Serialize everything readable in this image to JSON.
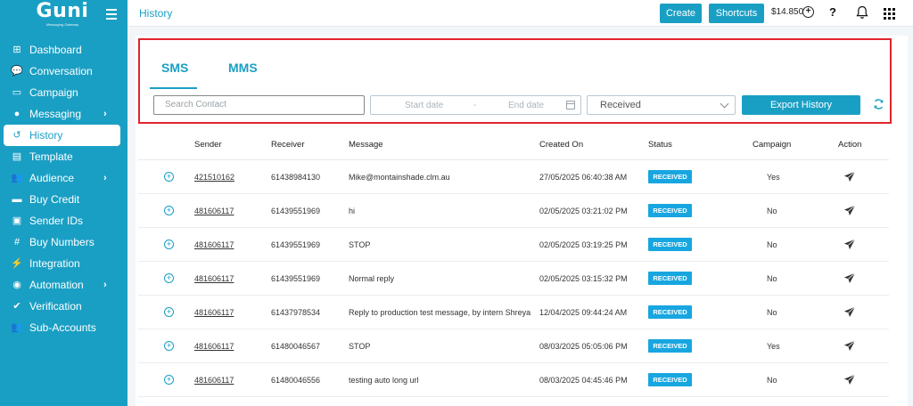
{
  "brand": {
    "logo_text": "Guni",
    "logo_sub": "Messaging Gateway"
  },
  "sidebar": {
    "items": [
      {
        "label": "Dashboard",
        "icon": "dashboard-icon",
        "glyph": "⊞",
        "has_submenu": false
      },
      {
        "label": "Conversation",
        "icon": "chat-icon",
        "glyph": "💬",
        "has_submenu": false
      },
      {
        "label": "Campaign",
        "icon": "inbox-icon",
        "glyph": "▭",
        "has_submenu": false
      },
      {
        "label": "Messaging",
        "icon": "message-icon",
        "glyph": "●",
        "has_submenu": true
      },
      {
        "label": "History",
        "icon": "history-icon",
        "glyph": "↺",
        "has_submenu": false,
        "active": true
      },
      {
        "label": "Template",
        "icon": "document-icon",
        "glyph": "▤",
        "has_submenu": false
      },
      {
        "label": "Audience",
        "icon": "users-icon",
        "glyph": "👥",
        "has_submenu": true
      },
      {
        "label": "Buy Credit",
        "icon": "wallet-icon",
        "glyph": "▬",
        "has_submenu": false
      },
      {
        "label": "Sender IDs",
        "icon": "id-card-icon",
        "glyph": "▣",
        "has_submenu": false
      },
      {
        "label": "Buy Numbers",
        "icon": "hash-icon",
        "glyph": "#",
        "has_submenu": false
      },
      {
        "label": "Integration",
        "icon": "plug-icon",
        "glyph": "⚡",
        "has_submenu": false
      },
      {
        "label": "Automation",
        "icon": "robot-icon",
        "glyph": "◉",
        "has_submenu": true
      },
      {
        "label": "Verification",
        "icon": "check-circle-icon",
        "glyph": "✔",
        "has_submenu": false
      },
      {
        "label": "Sub-Accounts",
        "icon": "accounts-icon",
        "glyph": "👥",
        "has_submenu": false
      }
    ]
  },
  "header": {
    "title": "History",
    "create_label": "Create",
    "shortcuts_label": "Shortcuts",
    "balance": "$14.850",
    "help_label": "?"
  },
  "tabs": [
    {
      "label": "SMS",
      "active": true
    },
    {
      "label": "MMS",
      "active": false
    }
  ],
  "filters": {
    "search_placeholder": "Search Contact",
    "start_date_placeholder": "Start date",
    "date_separator": "-",
    "end_date_placeholder": "End date",
    "direction_selected": "Received",
    "export_label": "Export History"
  },
  "table": {
    "columns": [
      "Sender",
      "Receiver",
      "Message",
      "Created On",
      "Status",
      "Campaign",
      "Action"
    ],
    "rows": [
      {
        "sender": "421510162",
        "receiver": "61438984130",
        "message": "Mike@montainshade.clm.au",
        "created_on": "27/05/2025 06:40:38 AM",
        "status": "RECEIVED",
        "campaign": "Yes"
      },
      {
        "sender": "481606117",
        "receiver": "61439551969",
        "message": "hi",
        "created_on": "02/05/2025 03:21:02 PM",
        "status": "RECEIVED",
        "campaign": "No"
      },
      {
        "sender": "481606117",
        "receiver": "61439551969",
        "message": "STOP",
        "created_on": "02/05/2025 03:19:25 PM",
        "status": "RECEIVED",
        "campaign": "No"
      },
      {
        "sender": "481606117",
        "receiver": "61439551969",
        "message": "Normal reply",
        "created_on": "02/05/2025 03:15:32 PM",
        "status": "RECEIVED",
        "campaign": "No"
      },
      {
        "sender": "481606117",
        "receiver": "61437978534",
        "message": "Reply to production test message, by intern Shreya",
        "created_on": "12/04/2025 09:44:24 AM",
        "status": "RECEIVED",
        "campaign": "No"
      },
      {
        "sender": "481606117",
        "receiver": "61480046567",
        "message": "STOP",
        "created_on": "08/03/2025 05:05:06 PM",
        "status": "RECEIVED",
        "campaign": "Yes"
      },
      {
        "sender": "481606117",
        "receiver": "61480046556",
        "message": "testing auto long url",
        "created_on": "08/03/2025 04:45:46 PM",
        "status": "RECEIVED",
        "campaign": "No"
      }
    ]
  },
  "colors": {
    "brand": "#1a9fc4",
    "highlight_border": "#e0242c",
    "badge": "#18a6e0"
  }
}
